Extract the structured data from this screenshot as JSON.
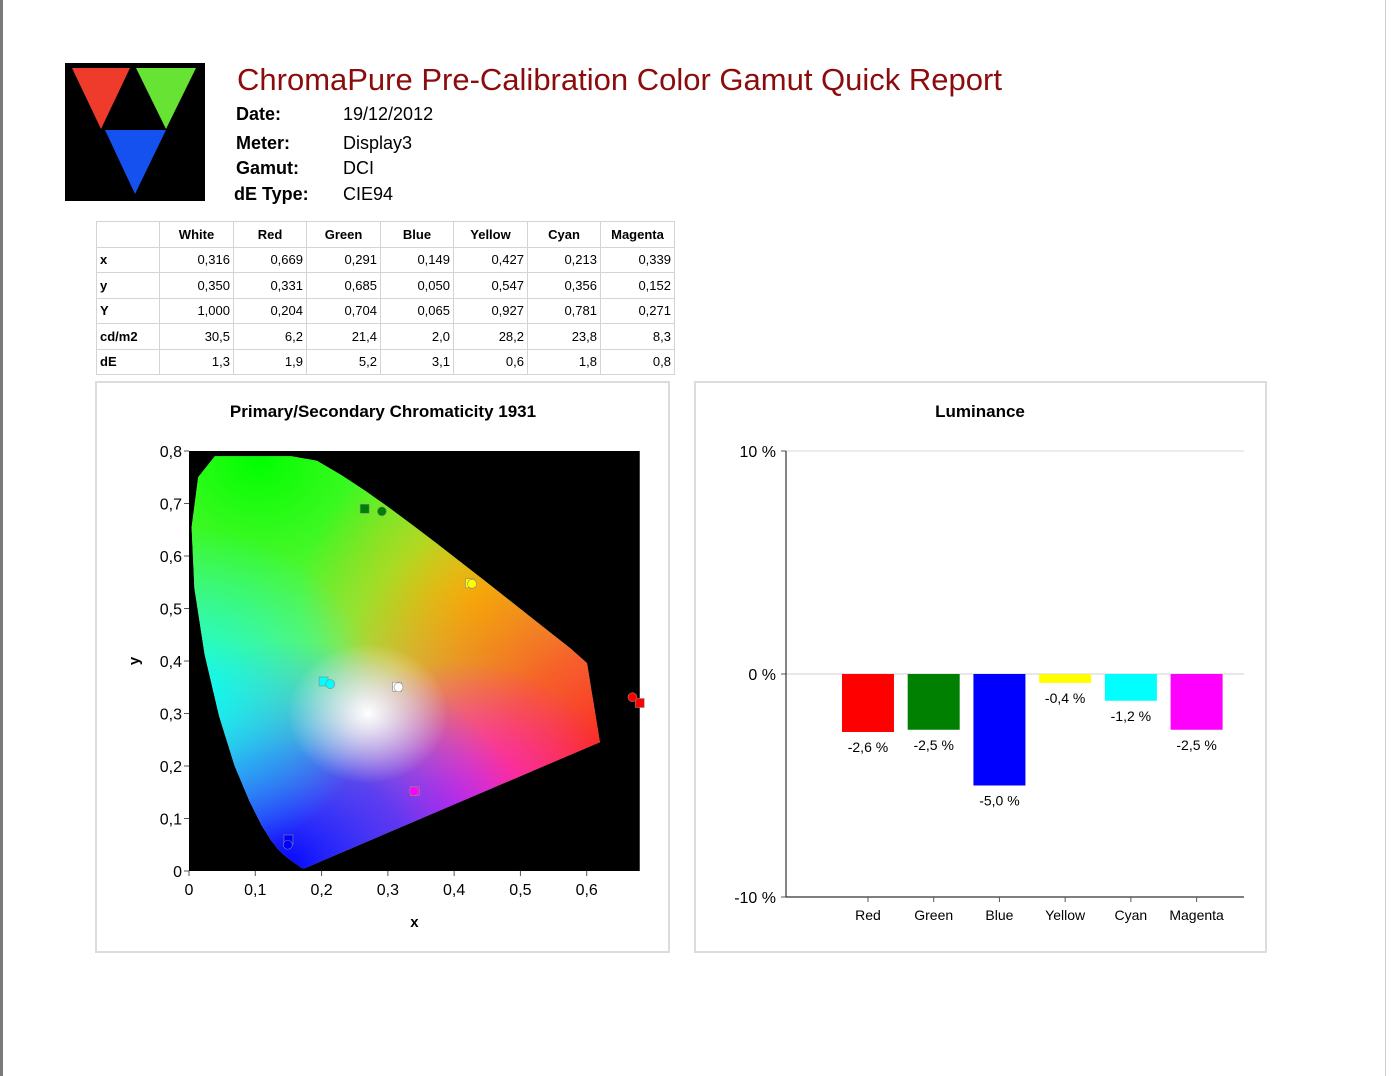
{
  "report": {
    "title": "ChromaPure Pre-Calibration Color Gamut Quick Report",
    "meta": [
      {
        "label": "Date:",
        "value": "19/12/2012"
      },
      {
        "label": "Meter:",
        "value": "Display3"
      },
      {
        "label": "Gamut:",
        "value": "DCI"
      },
      {
        "label": "dE Type:",
        "value": "CIE94"
      }
    ]
  },
  "logo": {
    "name": "chromapure-triangles-logo",
    "colors": [
      "#ee3b2c",
      "#66e333",
      "#1451ee"
    ]
  },
  "table": {
    "headers": [
      "White",
      "Red",
      "Green",
      "Blue",
      "Yellow",
      "Cyan",
      "Magenta"
    ],
    "rows": [
      {
        "label": "x",
        "values": [
          "0,316",
          "0,669",
          "0,291",
          "0,149",
          "0,427",
          "0,213",
          "0,339"
        ]
      },
      {
        "label": "y",
        "values": [
          "0,350",
          "0,331",
          "0,685",
          "0,050",
          "0,547",
          "0,356",
          "0,152"
        ]
      },
      {
        "label": "Y",
        "values": [
          "1,000",
          "0,204",
          "0,704",
          "0,065",
          "0,927",
          "0,781",
          "0,271"
        ]
      },
      {
        "label": "cd/m2",
        "values": [
          "30,5",
          "6,2",
          "21,4",
          "2,0",
          "28,2",
          "23,8",
          "8,3"
        ]
      },
      {
        "label": "dE",
        "values": [
          "1,3",
          "1,9",
          "5,2",
          "3,1",
          "0,6",
          "1,8",
          "0,8"
        ]
      }
    ]
  },
  "chart_data": [
    {
      "type": "scatter",
      "title": "Primary/Secondary Chromaticity 1931",
      "xlabel": "x",
      "ylabel": "y",
      "xlim": [
        0,
        0.7
      ],
      "ylim": [
        0,
        0.8
      ],
      "xticks": [
        0,
        0.1,
        0.2,
        0.3,
        0.4,
        0.5,
        0.6
      ],
      "xtick_labels": [
        "0",
        "0,1",
        "0,2",
        "0,3",
        "0,4",
        "0,5",
        "0,6"
      ],
      "yticks": [
        0,
        0.1,
        0.2,
        0.3,
        0.4,
        0.5,
        0.6,
        0.7,
        0.8
      ],
      "ytick_labels": [
        "0",
        "0,1",
        "0,2",
        "0,3",
        "0,4",
        "0,5",
        "0,6",
        "0,7",
        "0,8"
      ],
      "background": "#000000",
      "series": [
        {
          "marker": "square",
          "points": [
            {
              "color": "White",
              "x": 0.314,
              "y": 0.351,
              "fill": "#ffffff"
            },
            {
              "color": "Red",
              "x": 0.68,
              "y": 0.32,
              "fill": "#ff0000"
            },
            {
              "color": "Green",
              "x": 0.265,
              "y": 0.69,
              "fill": "#008000"
            },
            {
              "color": "Blue",
              "x": 0.15,
              "y": 0.06,
              "fill": "#0000ff"
            },
            {
              "color": "Yellow",
              "x": 0.424,
              "y": 0.548,
              "fill": "#ffff00"
            },
            {
              "color": "Cyan",
              "x": 0.203,
              "y": 0.361,
              "fill": "#00ffff"
            },
            {
              "color": "Magenta",
              "x": 0.341,
              "y": 0.152,
              "fill": "#ff00ff"
            }
          ]
        },
        {
          "marker": "circle",
          "points": [
            {
              "color": "White",
              "x": 0.316,
              "y": 0.35,
              "fill": "#ffffff"
            },
            {
              "color": "Red",
              "x": 0.669,
              "y": 0.331,
              "fill": "#ff0000"
            },
            {
              "color": "Green",
              "x": 0.291,
              "y": 0.685,
              "fill": "#008000"
            },
            {
              "color": "Blue",
              "x": 0.149,
              "y": 0.05,
              "fill": "#0000ff"
            },
            {
              "color": "Yellow",
              "x": 0.427,
              "y": 0.547,
              "fill": "#ffff00"
            },
            {
              "color": "Cyan",
              "x": 0.213,
              "y": 0.356,
              "fill": "#00ffff"
            },
            {
              "color": "Magenta",
              "x": 0.339,
              "y": 0.152,
              "fill": "#ff00ff"
            }
          ]
        }
      ]
    },
    {
      "type": "bar",
      "title": "Luminance",
      "categories": [
        "Red",
        "Green",
        "Blue",
        "Yellow",
        "Cyan",
        "Magenta"
      ],
      "values": [
        -2.6,
        -2.5,
        -5.0,
        -0.4,
        -1.2,
        -2.5
      ],
      "value_labels": [
        "-2,6 %",
        "-2,5 %",
        "-5,0 %",
        "-0,4 %",
        "-1,2 %",
        "-2,5 %"
      ],
      "colors": [
        "#ff0000",
        "#008000",
        "#0000ff",
        "#ffff00",
        "#00ffff",
        "#ff00ff"
      ],
      "ylim": [
        -10,
        10
      ],
      "yticks": [
        10,
        0,
        -10
      ],
      "ytick_labels": [
        "10 %",
        "0 %",
        "-10 %"
      ]
    }
  ]
}
